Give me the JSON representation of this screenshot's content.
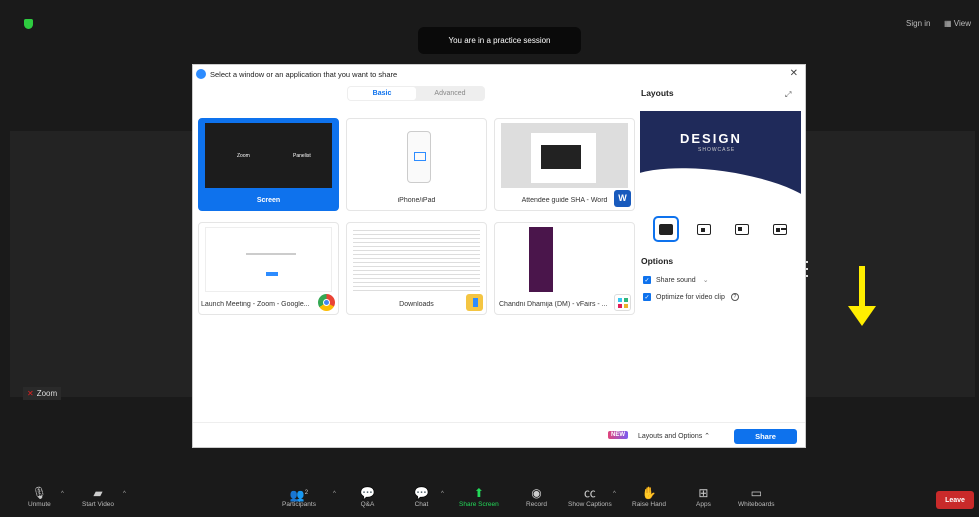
{
  "top": {
    "banner": "You are in a practice session",
    "sign_in": "Sign in",
    "view": "View"
  },
  "tile_label": "Zoom",
  "dialog": {
    "title": "Select a window or an application that you want to share",
    "tabs": [
      "Basic",
      "Advanced"
    ],
    "tiles": [
      {
        "label": "Screen",
        "thumb_left": "Zoom",
        "thumb_right": "Panelist"
      },
      {
        "label": "iPhone/iPad"
      },
      {
        "label": "Attendee guide SHA - Word"
      },
      {
        "label": "Launch Meeting - Zoom - Google..."
      },
      {
        "label": "Downloads"
      },
      {
        "label": "Chandni Dhamija (DM) - vFairs - ..."
      }
    ],
    "layouts_title": "Layouts",
    "preview_title": "DESIGN",
    "preview_subtitle": "SHOWCASE",
    "options_title": "Options",
    "share_sound": "Share sound",
    "optimize_video": "Optimize for video clip",
    "new_badge": "NEW",
    "layouts_and_options": "Layouts and Options",
    "share": "Share"
  },
  "toolbar": {
    "unmute": "Unmute",
    "start_video": "Start Video",
    "participants": "Participants",
    "participants_count": "2",
    "qa": "Q&A",
    "chat": "Chat",
    "share_screen": "Share Screen",
    "record": "Record",
    "show_captions": "Show Captions",
    "raise_hand": "Raise Hand",
    "apps": "Apps",
    "whiteboards": "Whiteboards",
    "leave": "Leave"
  },
  "colors": {
    "accent": "#0e72ed",
    "share_green": "#23d959",
    "leave_red": "#c92a2a",
    "arrow_yellow": "#ffee00"
  }
}
